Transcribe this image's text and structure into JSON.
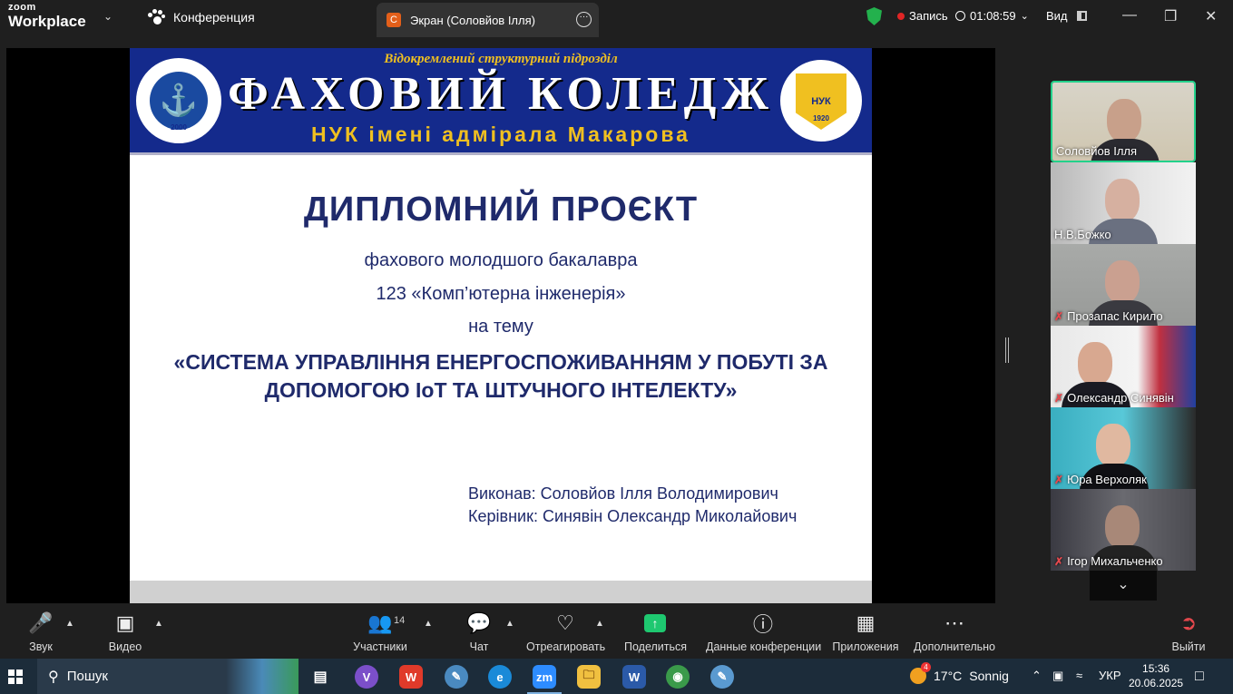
{
  "topbar": {
    "brand_top": "zoom",
    "brand_bottom": "Workplace",
    "conference_tab": "Конференция",
    "screen_tab": "Экран (Соловйов Ілля)",
    "screen_tab_letter": "С",
    "record_label": "Запись",
    "timer": "01:08:59",
    "view_label": "Вид"
  },
  "slide": {
    "banner_sub": "Відокремлений структурний підрозділ",
    "banner_main": "ФАХОВИЙ КОЛЕДЖ",
    "banner_nuk": "НУК імені адмірала Макарова",
    "logo_left_year": "2000",
    "logo_right_text": "НУК",
    "logo_right_year": "1920",
    "title": "ДИПЛОМНИЙ ПРОЄКТ",
    "line1": "фахового  молодшого бакалавра",
    "line2": "123 «Комп’ютерна інженерія»",
    "line3": "на тему",
    "topic_1": "«СИСТЕМА УПРАВЛІННЯ ЕНЕРГОСПОЖИВАННЯМ У ПОБУТІ ЗА",
    "topic_2": "ДОПОМОГОЮ IoT ТА ШТУЧНОГО ІНТЕЛЕКТУ»",
    "author": "Виконав: Соловйов Ілля Володимирович",
    "supervisor": "Керівник: Синявін Олександр Миколайович"
  },
  "participants": [
    {
      "name": "Соловйов Ілля",
      "muted": false,
      "active": true
    },
    {
      "name": "Н.В.Божко",
      "muted": false,
      "active": false
    },
    {
      "name": "Прозапас Кирило",
      "muted": true,
      "active": false
    },
    {
      "name": "Олександр Синявін",
      "muted": true,
      "active": false
    },
    {
      "name": "Юра Верхоляк",
      "muted": true,
      "active": false
    },
    {
      "name": "Ігор Михальченко",
      "muted": true,
      "active": false
    }
  ],
  "toolbar": {
    "audio": "Звук",
    "video": "Видео",
    "participants": "Участники",
    "participants_count": "14",
    "chat": "Чат",
    "react": "Отреагировать",
    "share": "Поделиться",
    "info": "Данные конференции",
    "apps": "Приложения",
    "more": "Дополнительно",
    "leave": "Выйти"
  },
  "taskbar": {
    "search": "Пошук",
    "weather_temp": "17°C",
    "weather_text": "Sonnig",
    "weather_badge": "4",
    "lang": "УКР",
    "time": "15:36",
    "date": "20.06.2025"
  },
  "colors": {
    "accent_green": "#23d18b",
    "share_green": "#1ec870",
    "record_red": "#e02525",
    "slide_blue": "#1f2a6b",
    "banner_blue": "#142a8c",
    "banner_gold": "#f0c020"
  }
}
